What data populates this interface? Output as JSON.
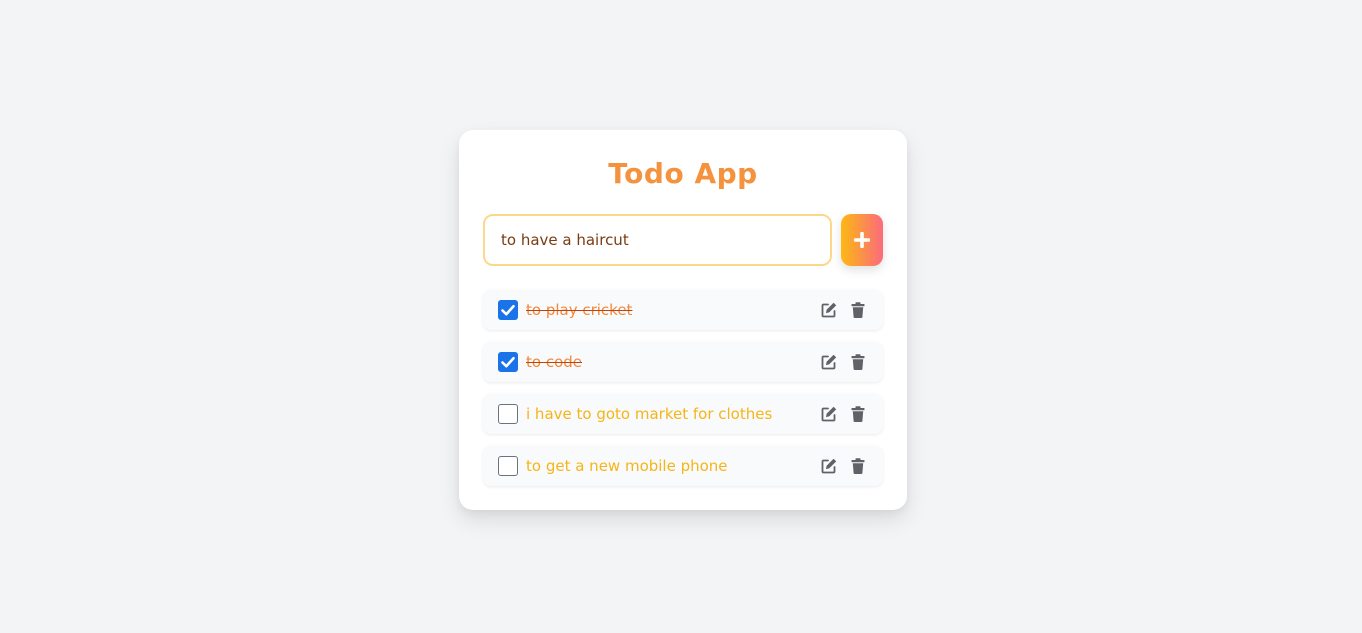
{
  "app": {
    "title": "Todo App"
  },
  "input": {
    "value": "to have a haircut",
    "placeholder": ""
  },
  "add_button": {
    "icon": "plus-icon"
  },
  "todos": [
    {
      "text": "to play cricket",
      "completed": true
    },
    {
      "text": "to code",
      "completed": true
    },
    {
      "text": "i have to goto market for clothes",
      "completed": false
    },
    {
      "text": "to get a new mobile phone",
      "completed": false
    }
  ],
  "icons": {
    "edit": "edit-icon",
    "delete": "trash-icon",
    "check": "checkmark-icon"
  },
  "colors": {
    "background": "#f3f4f6",
    "title": "#f5923e",
    "completed_text": "#f08a3a",
    "pending_text": "#f6b516",
    "checkbox_checked": "#1a73e8",
    "action_icon": "#5f6368",
    "input_border": "#fcd98a"
  }
}
